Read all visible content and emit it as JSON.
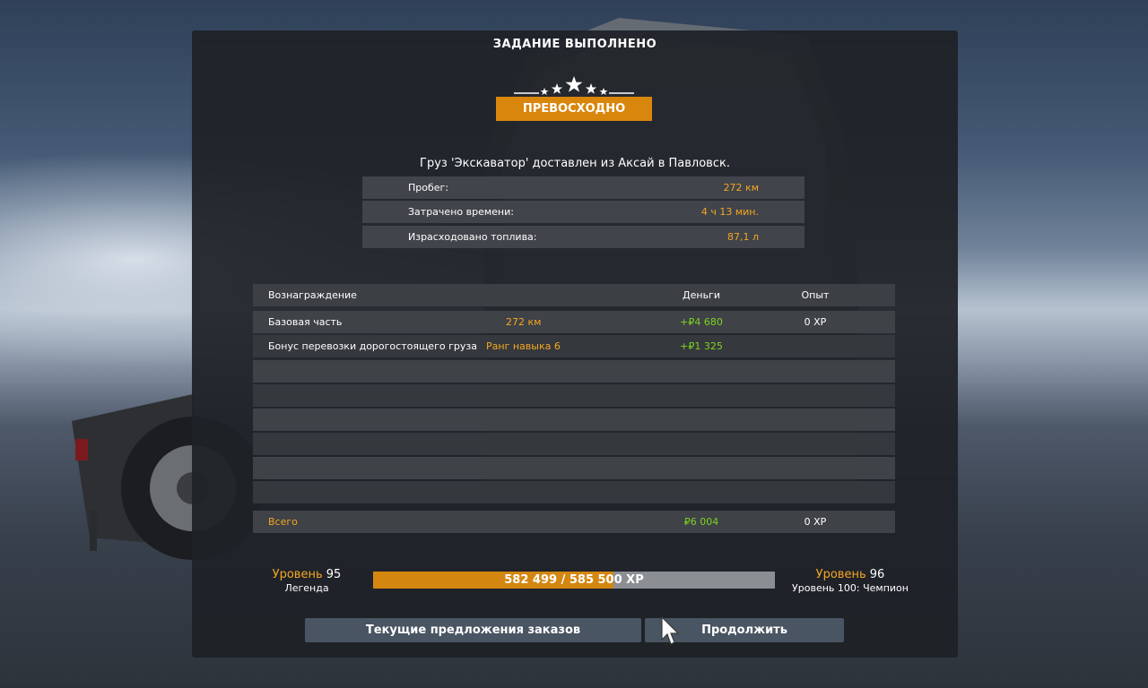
{
  "dialog": {
    "title": "ЗАДАНИЕ ВЫПОЛНЕНО",
    "rating_label": "ПРЕВОСХОДНО",
    "rating_stars": 5,
    "delivery_text": "Груз 'Экскаватор' доставлен из Аксай в Павловск."
  },
  "stats": [
    {
      "label": "Пробег:",
      "value": "272 км"
    },
    {
      "label": "Затрачено времени:",
      "value": "4 ч 13 мин."
    },
    {
      "label": "Израсходовано топлива:",
      "value": "87,1 л"
    }
  ],
  "rewards": {
    "headers": {
      "name": "Вознаграждение",
      "money": "Деньги",
      "xp": "Опыт"
    },
    "rows": [
      {
        "name": "Базовая часть",
        "detail": "272 км",
        "money": "+₽4 680",
        "xp": "0 XP"
      },
      {
        "name": "Бонус перевозки дорогостоящего груза",
        "detail": "Ранг навыка 6",
        "money": "+₽1 325",
        "xp": ""
      }
    ],
    "total": {
      "label": "Всего",
      "money": "₽6 004",
      "xp": "0 XP"
    }
  },
  "level": {
    "current_word": "Уровень",
    "current_num": "95",
    "current_title": "Легенда",
    "next_word": "Уровень",
    "next_num": "96",
    "next_title": "Уровень 100: Чемпион",
    "xp_text": "582 499 / 585 500 XP",
    "xp_fraction": 0.5978
  },
  "buttons": {
    "offers": "Текущие предложения заказов",
    "continue": "Продолжить"
  },
  "colors": {
    "accent": "#d9860c",
    "value_orange": "#f5a623",
    "money_green": "#7ed321",
    "button": "#4a5563"
  }
}
